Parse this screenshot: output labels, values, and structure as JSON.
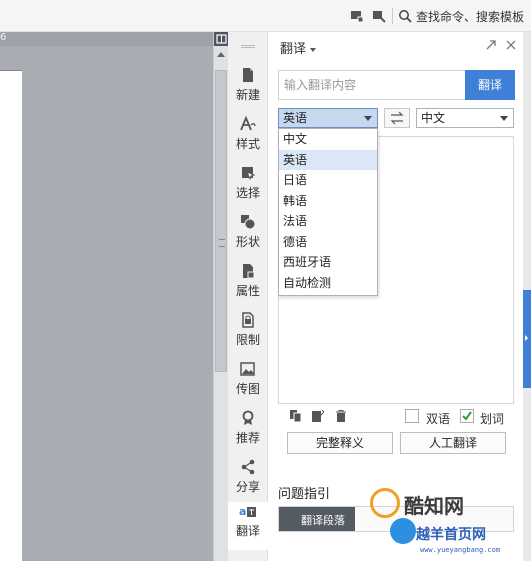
{
  "topbar": {
    "search_label": "查找命令、搜索模板"
  },
  "document": {
    "ruler_mark": "6"
  },
  "sidebar": {
    "items": [
      {
        "label": "新建",
        "icon": "new-doc-icon"
      },
      {
        "label": "样式",
        "icon": "style-icon"
      },
      {
        "label": "选择",
        "icon": "select-icon"
      },
      {
        "label": "形状",
        "icon": "shape-icon"
      },
      {
        "label": "属性",
        "icon": "properties-icon"
      },
      {
        "label": "限制",
        "icon": "restrict-icon"
      },
      {
        "label": "传图",
        "icon": "upload-image-icon"
      },
      {
        "label": "推荐",
        "icon": "recommend-icon"
      },
      {
        "label": "分享",
        "icon": "share-icon"
      },
      {
        "label": "翻译",
        "icon": "translate-icon"
      }
    ]
  },
  "panel": {
    "title": "翻译",
    "input_placeholder": "输入翻译内容",
    "translate_button": "翻译",
    "source_lang": "英语",
    "target_lang": "中文",
    "dropdown_options": [
      "中文",
      "英语",
      "日语",
      "韩语",
      "法语",
      "德语",
      "西班牙语",
      "自动检测"
    ],
    "bilingual_label": "双语",
    "bilingual_checked": false,
    "word_select_label": "划词",
    "word_select_checked": true,
    "full_definition_button": "完整释义",
    "human_translate_button": "人工翻译",
    "help_title": "问题指引",
    "help_item": "翻译段落"
  },
  "watermark": {
    "brand": "酷知网",
    "brand2": "越羊首页网",
    "url": "www.yueyangbang.com"
  },
  "colors": {
    "accent": "#3f7fd8",
    "doc_background": "#a9adb3",
    "dropdown_highlight": "#dbe7f7"
  }
}
